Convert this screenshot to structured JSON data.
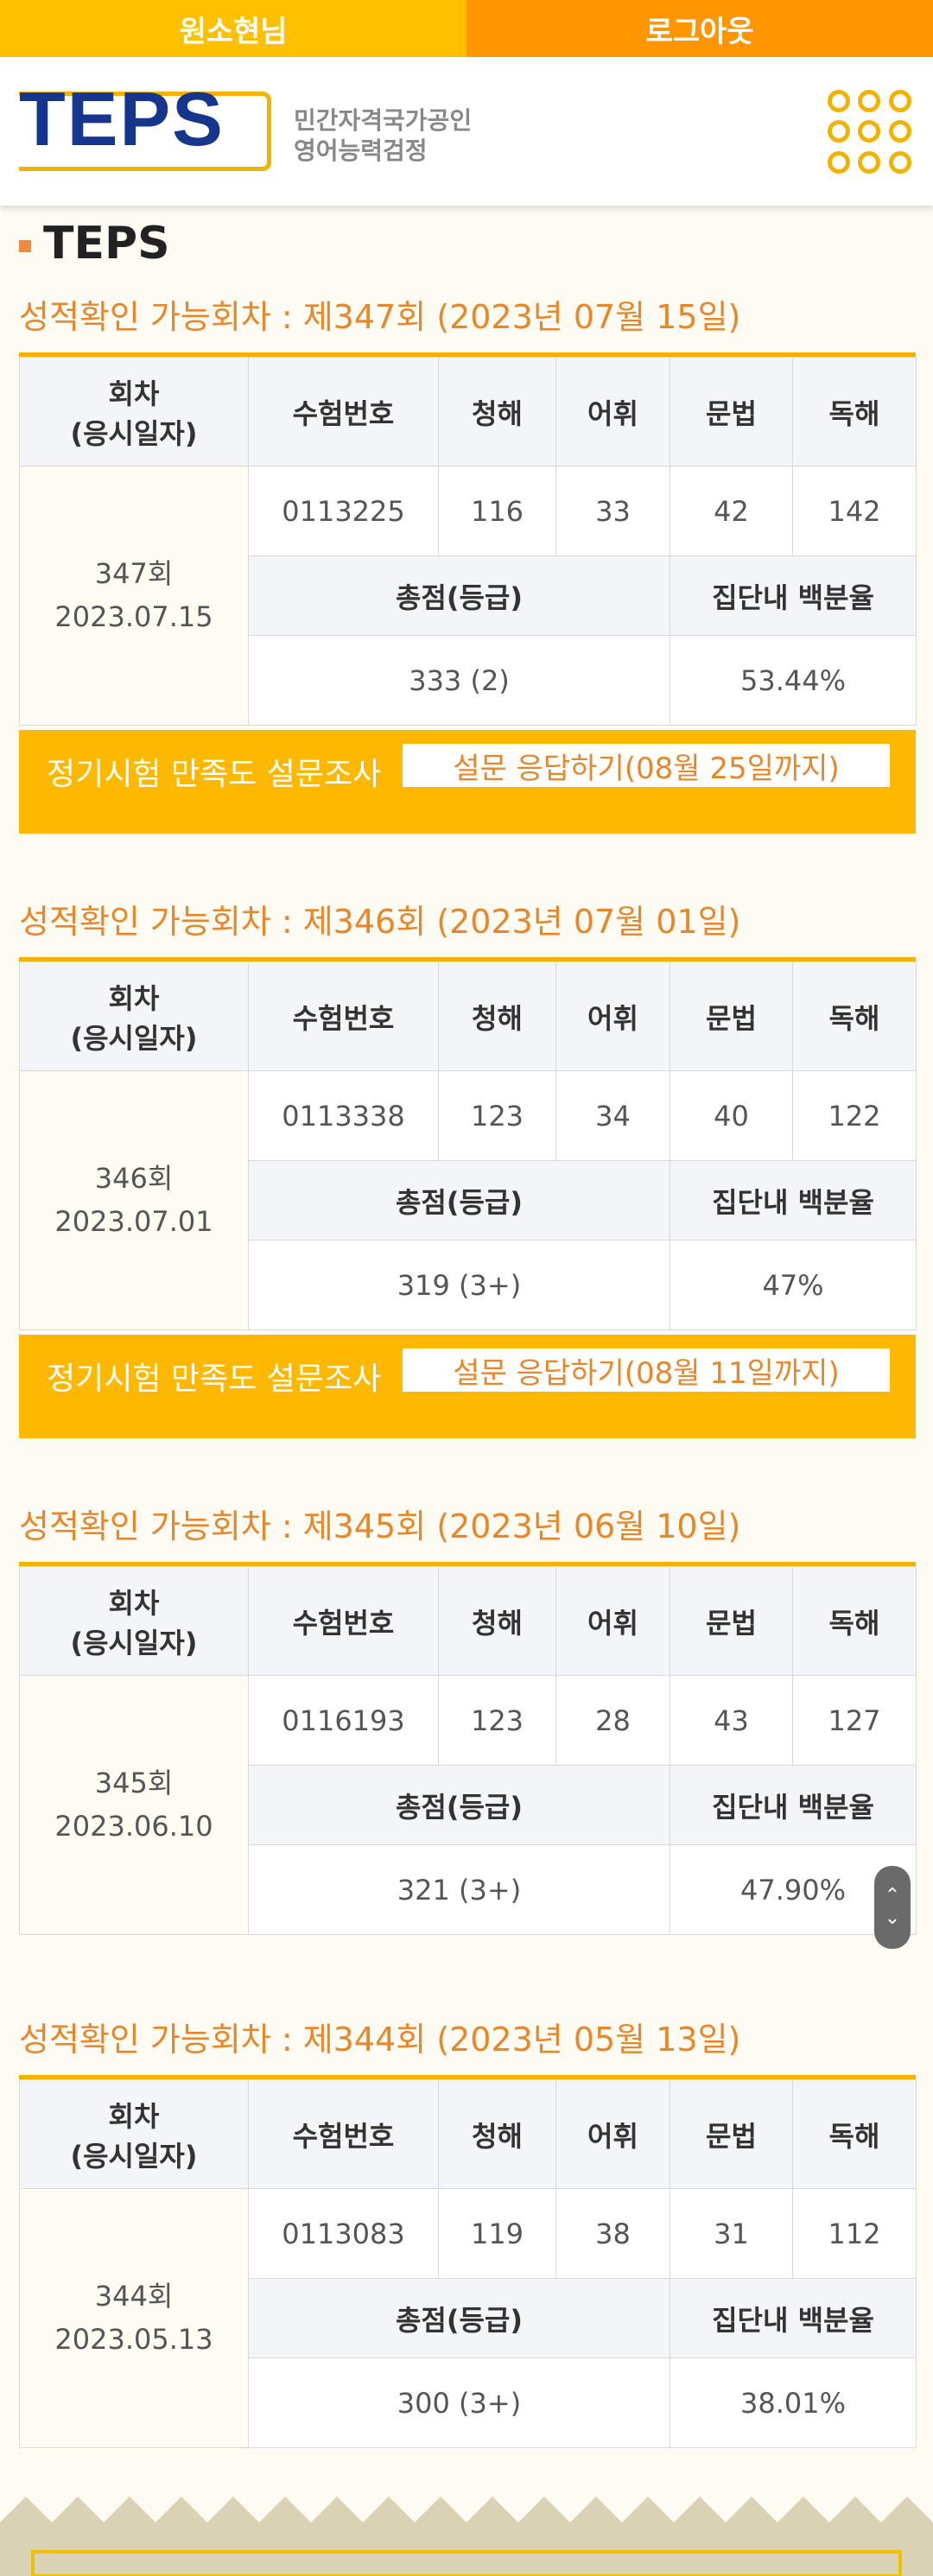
{
  "topbar": {
    "user_name": "원소현님",
    "logout_label": "로그아웃"
  },
  "header": {
    "logo_text": "TEPS",
    "logo_sub_line1": "민간자격국가공인",
    "logo_sub_line2": "영어능력검정"
  },
  "page": {
    "title": "TEPS"
  },
  "columns": {
    "round": "회차\n(응시일자)",
    "exam_no": "수험번호",
    "listening": "청해",
    "vocabulary": "어휘",
    "grammar": "문법",
    "reading": "독해",
    "total": "총점(등급)",
    "percentile": "집단내 백분율"
  },
  "sessions": [
    {
      "heading": "성적확인 가능회차 : 제347회 (2023년 07월 15일)",
      "round": "347회",
      "date": "2023.07.15",
      "exam_no": "0113225",
      "listening": "116",
      "vocabulary": "33",
      "grammar": "42",
      "reading": "142",
      "total": "333 (2)",
      "percentile": "53.44%",
      "survey_label": "정기시험 만족도 설문조사",
      "survey_button": "설문 응답하기(08월 25일까지)"
    },
    {
      "heading": "성적확인 가능회차 : 제346회 (2023년 07월 01일)",
      "round": "346회",
      "date": "2023.07.01",
      "exam_no": "0113338",
      "listening": "123",
      "vocabulary": "34",
      "grammar": "40",
      "reading": "122",
      "total": "319 (3+)",
      "percentile": "47%",
      "survey_label": "정기시험 만족도 설문조사",
      "survey_button": "설문 응답하기(08월 11일까지)"
    },
    {
      "heading": "성적확인 가능회차 : 제345회 (2023년 06월 10일)",
      "round": "345회",
      "date": "2023.06.10",
      "exam_no": "0116193",
      "listening": "123",
      "vocabulary": "28",
      "grammar": "43",
      "reading": "127",
      "total": "321 (3+)",
      "percentile": "47.90%"
    },
    {
      "heading": "성적확인 가능회차 : 제344회 (2023년 05월 13일)",
      "round": "344회",
      "date": "2023.05.13",
      "exam_no": "0113083",
      "listening": "119",
      "vocabulary": "38",
      "grammar": "31",
      "reading": "112",
      "total": "300 (3+)",
      "percentile": "38.01%"
    }
  ],
  "colors": {
    "accent_yellow": "#ffc000",
    "accent_orange": "#ff9600",
    "heading_orange": "#e8862a",
    "logo_blue": "#16358c"
  }
}
